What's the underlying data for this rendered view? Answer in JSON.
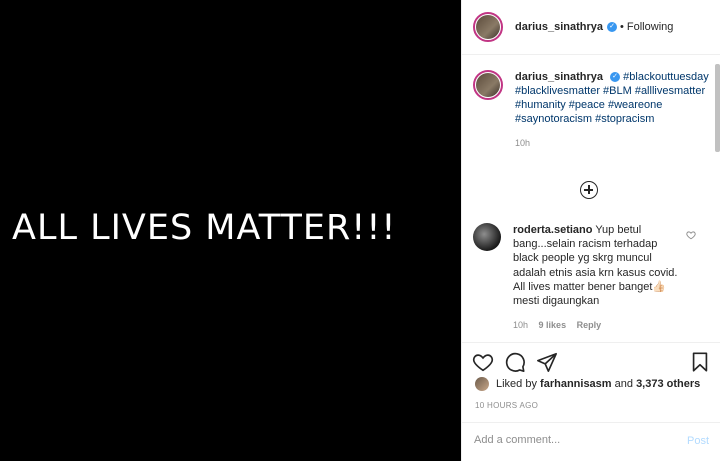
{
  "media": {
    "text": "ALL LIVES MATTER!!!"
  },
  "header": {
    "username": "darius_sinathrya",
    "separator": "•",
    "follow_status": "Following"
  },
  "caption": {
    "username": "darius_sinathrya",
    "hashtags": "#blackouttuesday #blacklivesmatter #BLM #alllivesmatter #humanity #peace #weareone #saynotoracism #stopracism",
    "time": "10h"
  },
  "comment": {
    "username": "roderta.setiano",
    "text": "Yup betul bang...selain racism terhadap black people yg skrg muncul adalah etnis asia krn kasus covid. All lives matter bener banget👍🏻 mesti digaungkan",
    "time": "10h",
    "likes": "9 likes",
    "reply": "Reply"
  },
  "likes": {
    "prefix": "Liked by ",
    "user": "farhannisasm",
    "middle": " and ",
    "count": "3,373 others"
  },
  "timestamp": "10 HOURS AGO",
  "add_comment": {
    "placeholder": "Add a comment...",
    "post_label": "Post"
  },
  "icons": {
    "like": "heart-icon",
    "comment": "comment-icon",
    "share": "send-icon",
    "save": "bookmark-icon",
    "load_more": "plus-circle-icon",
    "verified": "verified-badge-icon"
  },
  "colors": {
    "link": "#00376b",
    "verified": "#3897f0",
    "story_ring": "#c13584",
    "post_button": "#b3dbff"
  }
}
